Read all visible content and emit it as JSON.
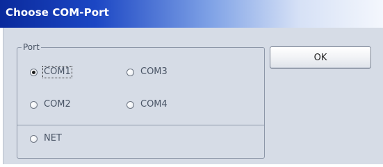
{
  "window": {
    "title": "Choose COM-Port"
  },
  "group": {
    "title": "Port"
  },
  "options": {
    "com1": {
      "label": "COM1",
      "checked": true,
      "focused": true
    },
    "com2": {
      "label": "COM2",
      "checked": false
    },
    "com3": {
      "label": "COM3",
      "checked": false
    },
    "com4": {
      "label": "COM4",
      "checked": false
    },
    "net": {
      "label": "NET",
      "checked": false
    }
  },
  "buttons": {
    "ok_label": "OK"
  },
  "colors": {
    "titlebar_start": "#0a2a9c",
    "titlebar_end": "#f4f7fd",
    "client_bg": "#d6dce6",
    "label_text": "#4a5566"
  }
}
